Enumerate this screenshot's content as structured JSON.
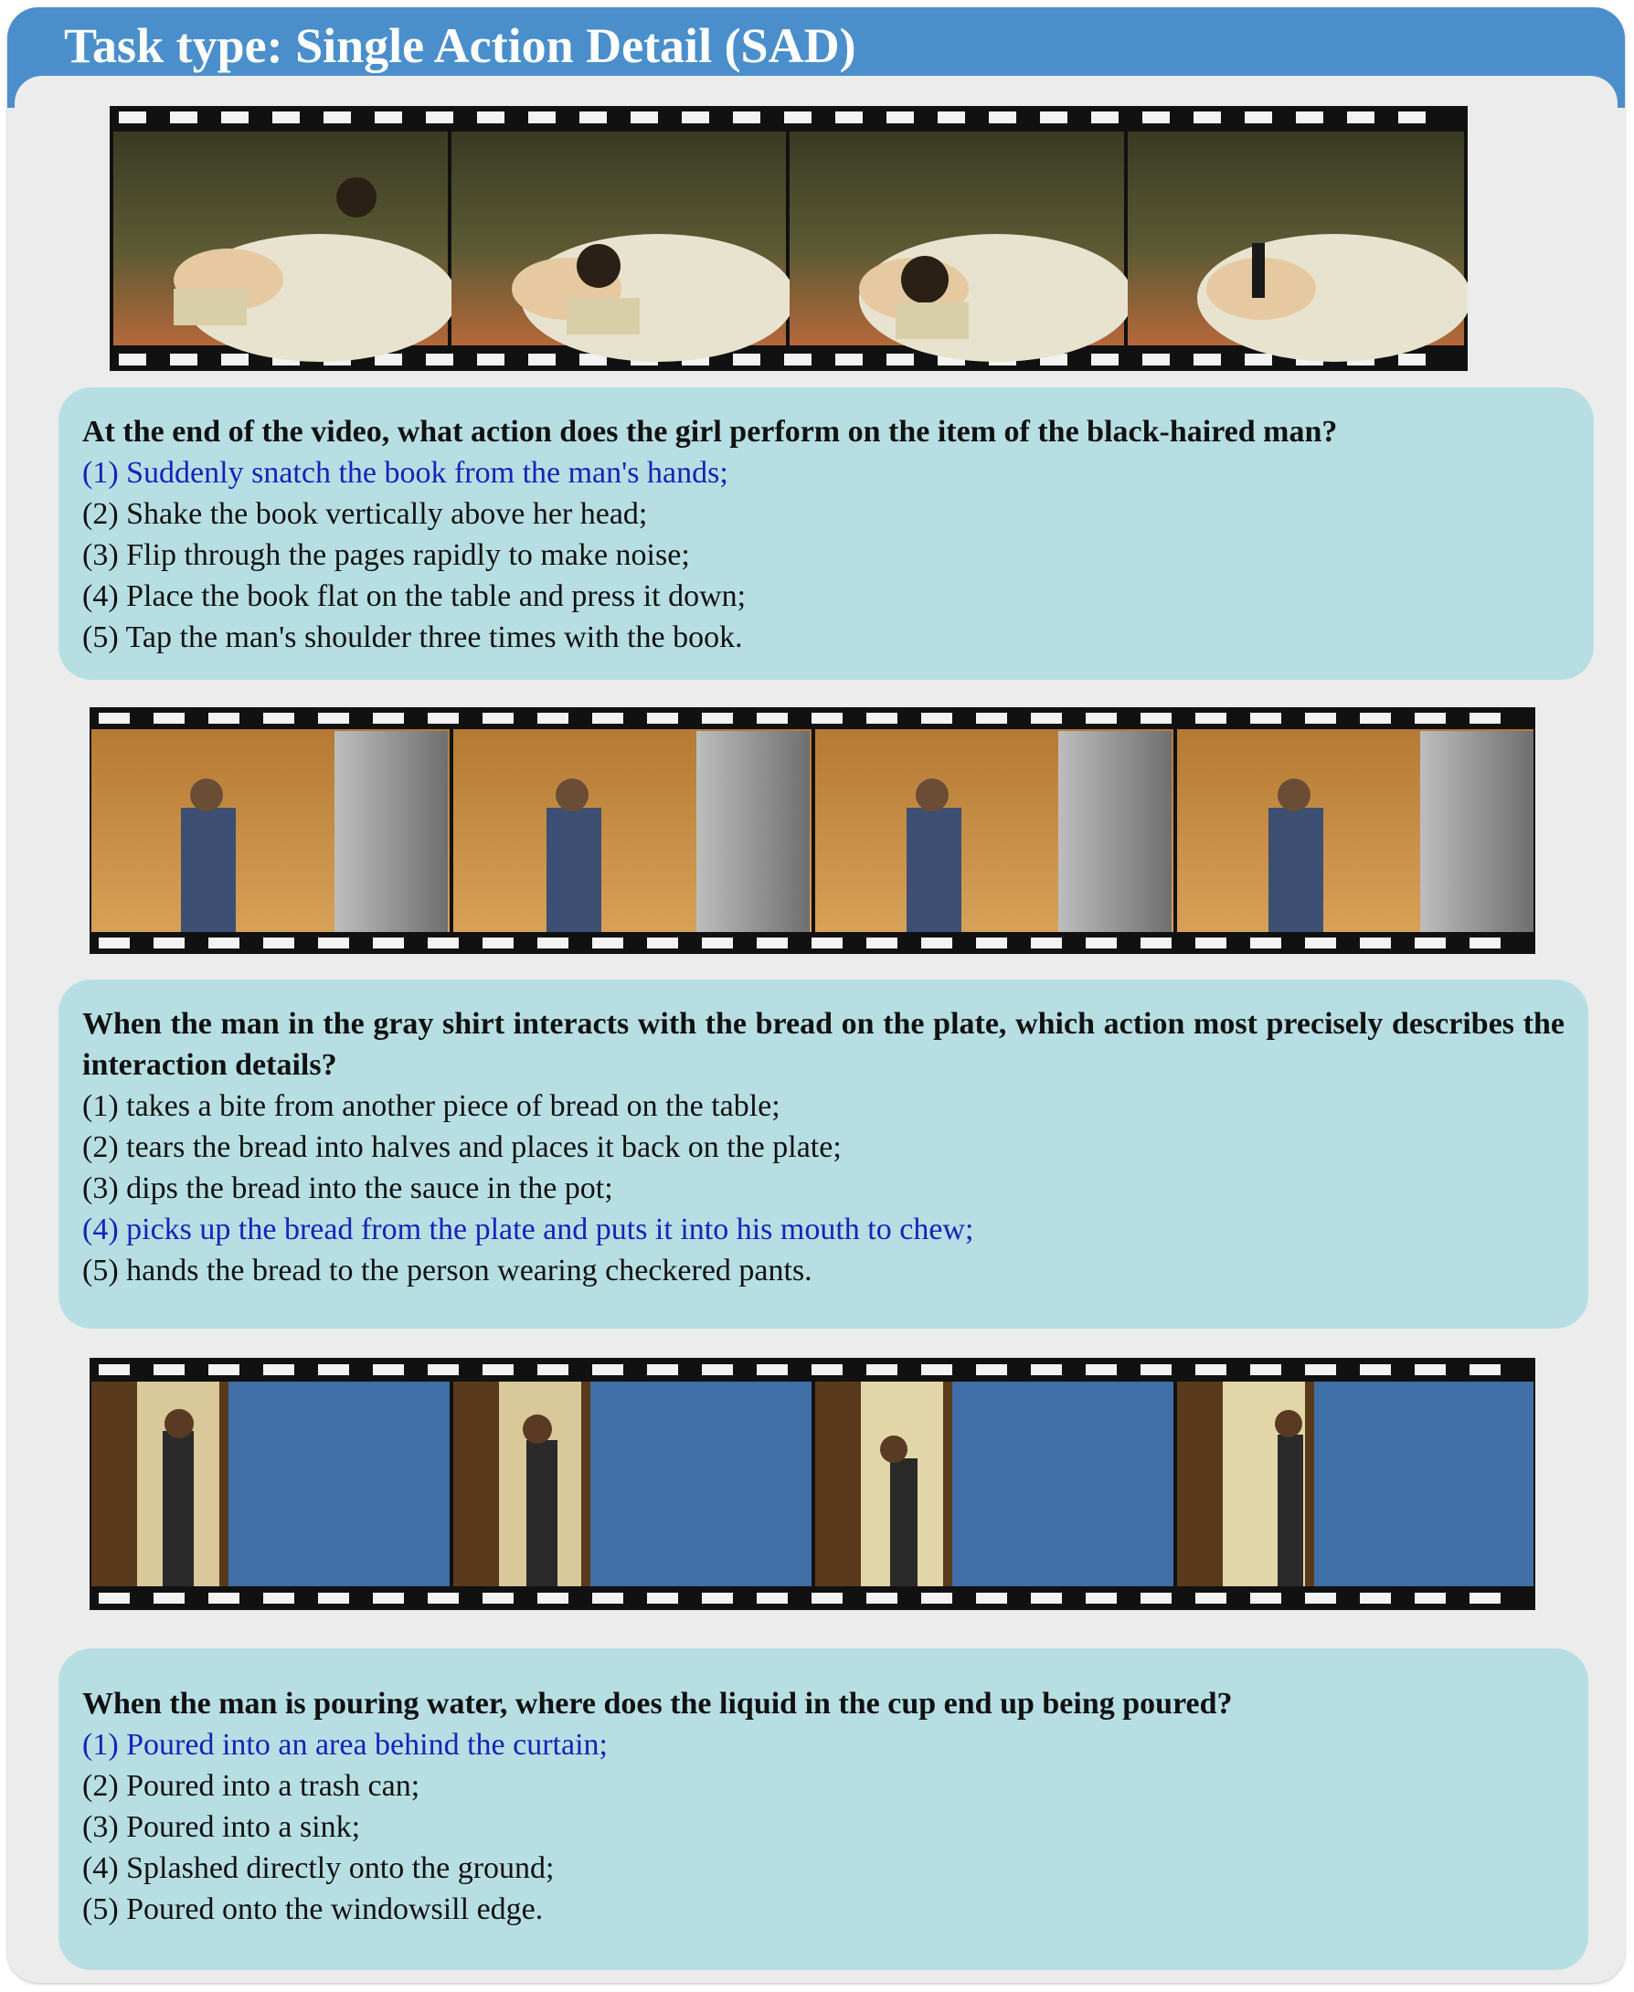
{
  "header": {
    "title": "Task type: Single Action Detail (SAD)"
  },
  "colors": {
    "header_blue": "#4a8fcb",
    "card_teal": "#b7dfe3",
    "correct_blue": "#1a21b8",
    "panel_gray": "#ececec"
  },
  "filmstrips": [
    {
      "scene": "animated-cartoon-kitchen",
      "frame_icon": "video-frame",
      "frames": 4
    },
    {
      "scene": "kitchen-man-bread",
      "frame_icon": "video-frame",
      "frames": 4
    },
    {
      "scene": "bathroom-doorway",
      "frame_icon": "video-frame",
      "frames": 4
    }
  ],
  "questions": [
    {
      "question": "At the end of the video, what action does the girl perform on the item of the black-haired man?",
      "options": [
        "(1) Suddenly snatch the book from the man's hands;",
        "(2) Shake the book vertically above her head;",
        "(3) Flip through the pages rapidly to make noise;",
        "(4) Place the book flat on the table and press it down;",
        "(5) Tap the man's shoulder three times with the book."
      ],
      "correct_index": 0
    },
    {
      "question": "When the man in the gray shirt interacts with the bread on the plate, which action most precisely describes the interaction details?",
      "options": [
        "(1) takes a bite from another piece of bread on the table;",
        "(2) tears the bread into halves and places it back on the plate;",
        "(3) dips the bread into the sauce in the pot;",
        "(4) picks up the bread from the plate and puts it into his mouth to chew;",
        "(5) hands the bread to the person wearing checkered pants."
      ],
      "correct_index": 3
    },
    {
      "question": "When the man is pouring water, where does the liquid in the cup end up being poured?",
      "options": [
        "(1) Poured into an area behind the curtain;",
        "(2) Poured into a trash can;",
        "(3) Poured into a sink;",
        "(4) Splashed directly onto the ground;",
        "(5) Poured onto the windowsill edge."
      ],
      "correct_index": 0
    }
  ]
}
